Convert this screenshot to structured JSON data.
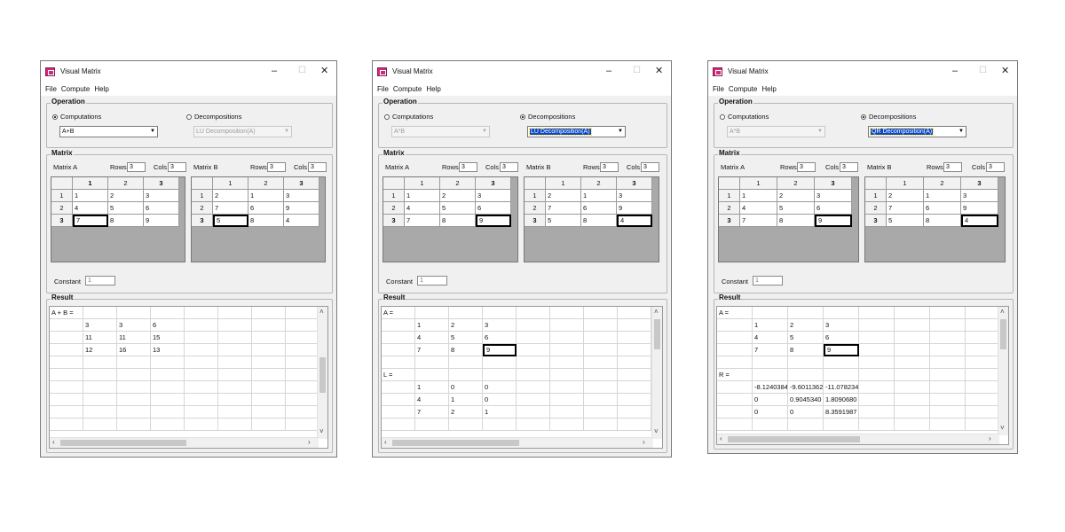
{
  "windows": [
    {
      "title": "Visual Matrix",
      "controls": {
        "minimize": "–",
        "maximize": "☐",
        "close": "✕"
      },
      "menu": [
        "File",
        "Compute",
        "Help"
      ],
      "operation": {
        "label": "Operation",
        "computations": {
          "label": "Computations",
          "selected": true,
          "value": "A+B",
          "enabled": true
        },
        "decompositions": {
          "label": "Decompositions",
          "selected": false,
          "value": "LU Decomposition(A)",
          "enabled": false
        }
      },
      "matrix": {
        "label": "Matrix",
        "a": {
          "label": "Matrix A",
          "rows_label": "Rows",
          "rows": "3",
          "cols_label": "Cols",
          "cols": "3",
          "headers": [
            "1",
            "2",
            "3"
          ],
          "row_headers": [
            "1",
            "2",
            "3"
          ],
          "cells": [
            [
              "1",
              "2",
              "3"
            ],
            [
              "4",
              "5",
              "6"
            ],
            [
              "7",
              "8",
              "9"
            ]
          ]
        },
        "b": {
          "label": "Matrix B",
          "rows_label": "Rows",
          "rows": "3",
          "cols_label": "Cols",
          "cols": "3",
          "headers": [
            "1",
            "2",
            "3"
          ],
          "row_headers": [
            "1",
            "2",
            "3"
          ],
          "cells": [
            [
              "2",
              "1",
              "3"
            ],
            [
              "7",
              "6",
              "9"
            ],
            [
              "5",
              "8",
              "4"
            ]
          ]
        },
        "constant_label": "Constant",
        "constant": "1"
      },
      "result": {
        "label": "Result",
        "blocks": [
          {
            "name": "A + B =",
            "rows": [
              [
                "3",
                "3",
                "6"
              ],
              [
                "11",
                "11",
                "15"
              ],
              [
                "12",
                "16",
                "13"
              ]
            ]
          }
        ]
      }
    },
    {
      "title": "Visual Matrix",
      "controls": {
        "minimize": "–",
        "maximize": "☐",
        "close": "✕"
      },
      "menu": [
        "File",
        "Compute",
        "Help"
      ],
      "operation": {
        "label": "Operation",
        "computations": {
          "label": "Computations",
          "selected": false,
          "value": "A*B",
          "enabled": false
        },
        "decompositions": {
          "label": "Decompositions",
          "selected": true,
          "value": "LU Decomposition(A)",
          "enabled": true
        }
      },
      "matrix": {
        "label": "Matrix",
        "a": {
          "label": "Matrix A",
          "rows_label": "Rows",
          "rows": "3",
          "cols_label": "Cols",
          "cols": "3",
          "headers": [
            "1",
            "2",
            "3"
          ],
          "row_headers": [
            "1",
            "2",
            "3"
          ],
          "cells": [
            [
              "1",
              "2",
              "3"
            ],
            [
              "4",
              "5",
              "6"
            ],
            [
              "7",
              "8",
              "9"
            ]
          ]
        },
        "b": {
          "label": "Matrix B",
          "rows_label": "Rows",
          "rows": "3",
          "cols_label": "Cols",
          "cols": "3",
          "headers": [
            "1",
            "2",
            "3"
          ],
          "row_headers": [
            "1",
            "2",
            "3"
          ],
          "cells": [
            [
              "2",
              "1",
              "3"
            ],
            [
              "7",
              "6",
              "9"
            ],
            [
              "5",
              "8",
              "4"
            ]
          ]
        },
        "constant_label": "Constant",
        "constant": "1"
      },
      "result": {
        "label": "Result",
        "blocks": [
          {
            "name": "A =",
            "rows": [
              [
                "1",
                "2",
                "3"
              ],
              [
                "4",
                "5",
                "6"
              ],
              [
                "7",
                "8",
                "9"
              ]
            ]
          },
          {
            "name": "L =",
            "rows": [
              [
                "1",
                "0",
                "0"
              ],
              [
                "4",
                "1",
                "0"
              ],
              [
                "7",
                "2",
                "1"
              ]
            ]
          }
        ]
      }
    },
    {
      "title": "Visual Matrix",
      "controls": {
        "minimize": "–",
        "maximize": "☐",
        "close": "✕"
      },
      "menu": [
        "File",
        "Compute",
        "Help"
      ],
      "operation": {
        "label": "Operation",
        "computations": {
          "label": "Computations",
          "selected": false,
          "value": "A*B",
          "enabled": false
        },
        "decompositions": {
          "label": "Decompositions",
          "selected": true,
          "value": "QR Decomposition(A)",
          "enabled": true
        }
      },
      "matrix": {
        "label": "Matrix",
        "a": {
          "label": "Matrix A",
          "rows_label": "Rows",
          "rows": "3",
          "cols_label": "Cols",
          "cols": "3",
          "headers": [
            "1",
            "2",
            "3"
          ],
          "row_headers": [
            "1",
            "2",
            "3"
          ],
          "cells": [
            [
              "1",
              "2",
              "3"
            ],
            [
              "4",
              "5",
              "6"
            ],
            [
              "7",
              "8",
              "9"
            ]
          ]
        },
        "b": {
          "label": "Matrix B",
          "rows_label": "Rows",
          "rows": "3",
          "cols_label": "Cols",
          "cols": "3",
          "headers": [
            "1",
            "2",
            "3"
          ],
          "row_headers": [
            "1",
            "2",
            "3"
          ],
          "cells": [
            [
              "2",
              "1",
              "3"
            ],
            [
              "7",
              "6",
              "9"
            ],
            [
              "5",
              "8",
              "4"
            ]
          ]
        },
        "constant_label": "Constant",
        "constant": "1"
      },
      "result": {
        "label": "Result",
        "blocks": [
          {
            "name": "A =",
            "rows": [
              [
                "1",
                "2",
                "3"
              ],
              [
                "4",
                "5",
                "6"
              ],
              [
                "7",
                "8",
                "9"
              ]
            ]
          },
          {
            "name": "R =",
            "rows": [
              [
                "-8.1240384",
                "-9.6011362",
                "-11.078234"
              ],
              [
                "0",
                "0.9045340",
                "1.8090680"
              ],
              [
                "0",
                "0",
                "8.3591987"
              ]
            ]
          }
        ]
      }
    }
  ]
}
